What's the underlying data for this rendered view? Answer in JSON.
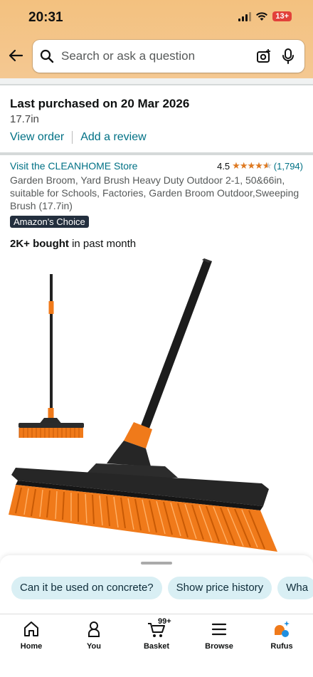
{
  "status_bar": {
    "time": "20:31",
    "battery": "13+"
  },
  "search": {
    "placeholder": "Search or ask a question"
  },
  "purchase": {
    "title": "Last purchased on 20 Mar 2026",
    "size": "17.7in",
    "view_order": "View order",
    "add_review": "Add a review"
  },
  "product": {
    "store_link": "Visit the CLEANHOME Store",
    "rating": "4.5",
    "rating_count": "(1,794)",
    "title": "Garden Broom, Yard Brush Heavy Duty Outdoor 2-1, 50&66in, suitable for Schools, Factories, Garden Broom Outdoor,Sweeping Brush (17.7in)",
    "badge": "Amazon's Choice",
    "bought_bold": "2K+ bought",
    "bought_rest": " in past month"
  },
  "chips": [
    "Can it be used on concrete?",
    "Show price history",
    "Wha"
  ],
  "nav": {
    "home": "Home",
    "you": "You",
    "basket": "Basket",
    "basket_count": "99+",
    "browse": "Browse",
    "rufus": "Rufus"
  },
  "colors": {
    "header_bg": "#f3c17f",
    "link": "#007185",
    "star": "#de7921",
    "badge_bg": "#232f3e",
    "chip_bg": "#d9eff4",
    "broom_orange": "#f07a1a"
  }
}
